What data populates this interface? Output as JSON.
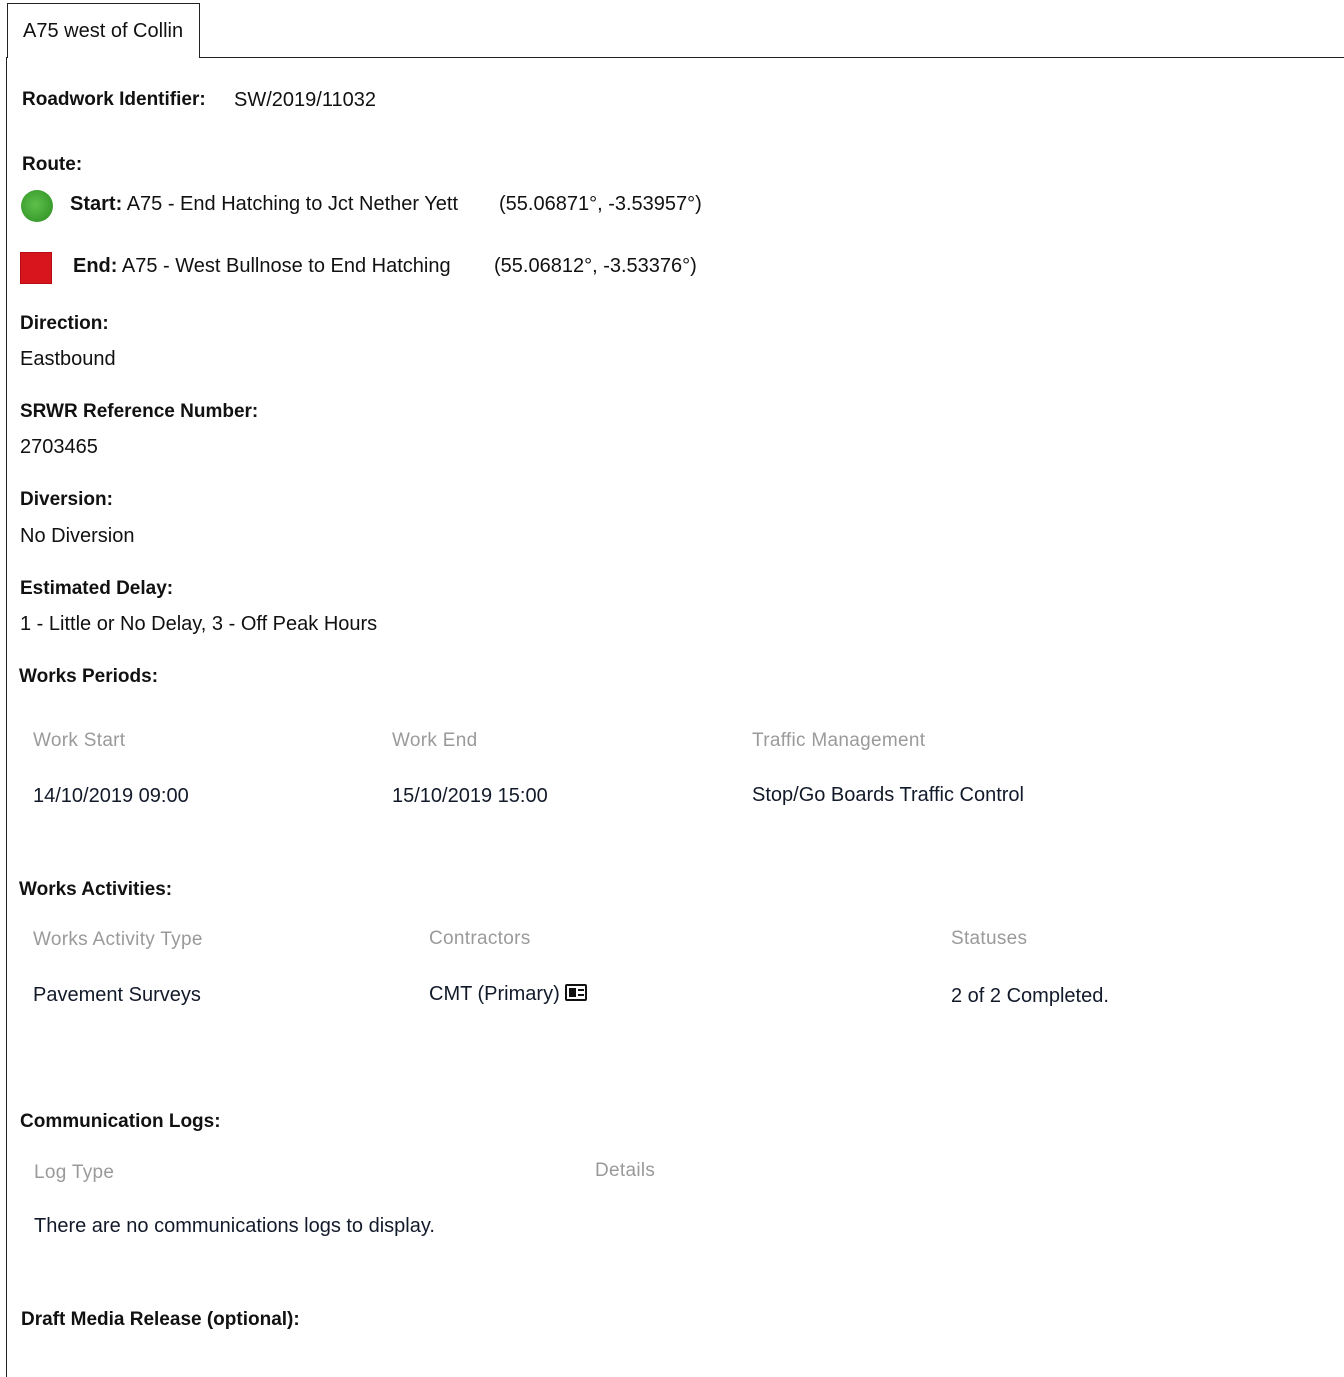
{
  "tab": {
    "title": "A75 west of Collin"
  },
  "identifier": {
    "label": "Roadwork Identifier:",
    "value": "SW/2019/11032"
  },
  "route": {
    "label": "Route:",
    "start": {
      "label": "Start:",
      "text": "A75 - End Hatching to Jct Nether Yett",
      "coords": "(55.06871°, -3.53957°)",
      "icon": "green-circle-marker"
    },
    "end": {
      "label": "End:",
      "text": "A75 - West Bullnose to End Hatching",
      "coords": "(55.06812°, -3.53376°)",
      "icon": "red-square-marker"
    }
  },
  "direction": {
    "label": "Direction:",
    "value": "Eastbound"
  },
  "srwr": {
    "label": "SRWR Reference Number:",
    "value": "2703465"
  },
  "diversion": {
    "label": "Diversion:",
    "value": "No Diversion"
  },
  "delay": {
    "label": "Estimated Delay:",
    "value": "1 - Little or No Delay, 3 - Off Peak Hours"
  },
  "works_periods": {
    "label": "Works Periods:",
    "headers": [
      "Work Start",
      "Work End",
      "Traffic Management"
    ],
    "rows": [
      [
        "14/10/2019 09:00",
        "15/10/2019 15:00",
        "Stop/Go Boards Traffic Control"
      ]
    ]
  },
  "works_activities": {
    "label": "Works Activities:",
    "headers": [
      "Works Activity Type",
      "Contractors",
      "Statuses"
    ],
    "rows": [
      {
        "type": "Pavement Surveys",
        "contractor": "CMT (Primary)",
        "contractor_icon": "contact-card-icon",
        "status": "2 of 2 Completed."
      }
    ]
  },
  "comm_logs": {
    "label": "Communication Logs:",
    "headers": [
      "Log Type",
      "Details"
    ],
    "empty_message": "There are no communications logs to display."
  },
  "media_release": {
    "label": "Draft Media Release (optional):"
  }
}
